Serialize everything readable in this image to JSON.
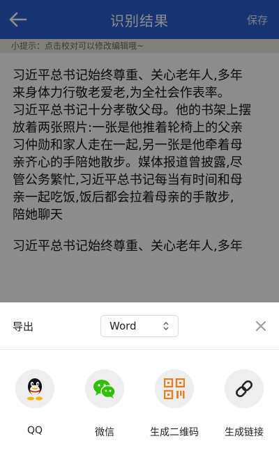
{
  "header": {
    "title": "识别结果",
    "save_label": "保存"
  },
  "hint": "小提示：点击校对可以修改编辑哦~",
  "content": {
    "paragraph_1": "习近平总书记始终尊重、关心老年人,多年\n来身体力行敬老爱老,为全社会作表率。\n习近平总书记十分孝敬父母。他的书架上摆\n放着两张照片:一张是他推着轮椅上的父亲\n习仲勋和家人走在一起,另一张是他牵着母\n亲齐心的手陪她散步。媒体报道曾披露,尽\n管公务繁忙,习近平总书记每当有时间和母\n亲一起吃饭,饭后都会拉着母亲的手散步,\n陪她聊天",
    "paragraph_2": "习近平总书记始终尊重、关心老年人,多年"
  },
  "sheet": {
    "export_label": "导出",
    "format_selected": "Word",
    "share_items": [
      {
        "label": "QQ",
        "icon": "qq-icon"
      },
      {
        "label": "微信",
        "icon": "wechat-icon"
      },
      {
        "label": "生成二维码",
        "icon": "qrcode-icon"
      },
      {
        "label": "生成链接",
        "icon": "link-icon"
      }
    ]
  },
  "colors": {
    "header_bg": "#2f5fd0",
    "hint_bg": "#eceae0",
    "qr_orange": "#e67e22",
    "wechat_green": "#2dc100"
  }
}
